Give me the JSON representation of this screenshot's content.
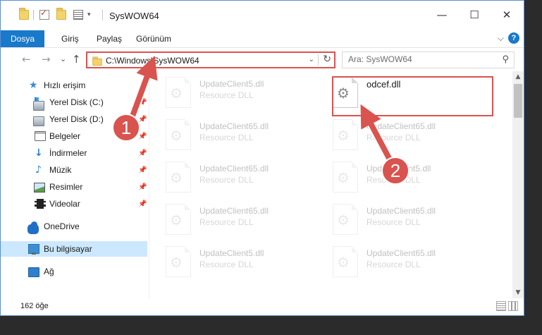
{
  "window": {
    "title": "SysWOW64",
    "minimize_glyph": "—",
    "maximize_glyph": "☐",
    "close_glyph": "✕"
  },
  "ribbon": {
    "tabs": [
      {
        "label": "Dosya",
        "active": true
      },
      {
        "label": "Giriş"
      },
      {
        "label": "Paylaş"
      },
      {
        "label": "Görünüm"
      }
    ],
    "expand_glyph": "⌵",
    "help_glyph": "?"
  },
  "navbar": {
    "back_glyph": "←",
    "forward_glyph": "→",
    "recent_glyph": "⌄",
    "up_glyph": "↑",
    "address": "C:\\Windows\\SysWOW64",
    "refresh_glyph": "↻",
    "dropdown_glyph": "⌄",
    "search_placeholder": "Ara: SysWOW64",
    "search_glyph": "⚲"
  },
  "sidebar": {
    "items": [
      {
        "label": "Hızlı erişim",
        "icon": "star-icon"
      },
      {
        "label": "Yerel Disk (C:)",
        "icon": "drive-c-icon",
        "pinned": true
      },
      {
        "label": "Yerel Disk (D:)",
        "icon": "drive-d-icon",
        "pinned": true
      },
      {
        "label": "Belgeler",
        "icon": "documents-icon",
        "pinned": true
      },
      {
        "label": "İndirmeler",
        "icon": "downloads-icon",
        "pinned": true
      },
      {
        "label": "Müzik",
        "icon": "music-icon",
        "pinned": true
      },
      {
        "label": "Resimler",
        "icon": "pictures-icon",
        "pinned": true
      },
      {
        "label": "Videolar",
        "icon": "videos-icon",
        "pinned": true
      },
      {
        "label": "OneDrive",
        "icon": "onedrive-icon"
      },
      {
        "label": "Bu bilgisayar",
        "icon": "this-pc-icon",
        "selected": true
      },
      {
        "label": "Ağ",
        "icon": "network-icon"
      }
    ],
    "pin_glyph": "📌"
  },
  "files": {
    "left_column": [
      {
        "name": "UpdateClient5.dll",
        "type": "Resource DLL"
      },
      {
        "name": "UpdateClient65.dll",
        "type": "Resource DLL"
      },
      {
        "name": "UpdateClient65.dll",
        "type": "Resource DLL"
      },
      {
        "name": "UpdateClient65.dll",
        "type": "Resource DLL"
      },
      {
        "name": "UpdateClient5.dll",
        "type": "Resource DLL"
      }
    ],
    "right_column": [
      {
        "name": "odcef.dll",
        "type": ""
      },
      {
        "name": "UpdateClient65.dll",
        "type": "Resource DLL"
      },
      {
        "name": "UpdateClient5.dll",
        "type": "Resource DLL"
      },
      {
        "name": "UpdateClient65.dll",
        "type": "Resource DLL"
      },
      {
        "name": "UpdateClient65.dll",
        "type": "Resource DLL"
      }
    ]
  },
  "status": {
    "item_count": "162 öğe"
  },
  "annotations": {
    "callout_1": "1",
    "callout_2": "2",
    "color": "#d9534f"
  },
  "colors": {
    "accent": "#1979ca",
    "selection": "#cce8ff",
    "highlight": "#d9534f"
  }
}
